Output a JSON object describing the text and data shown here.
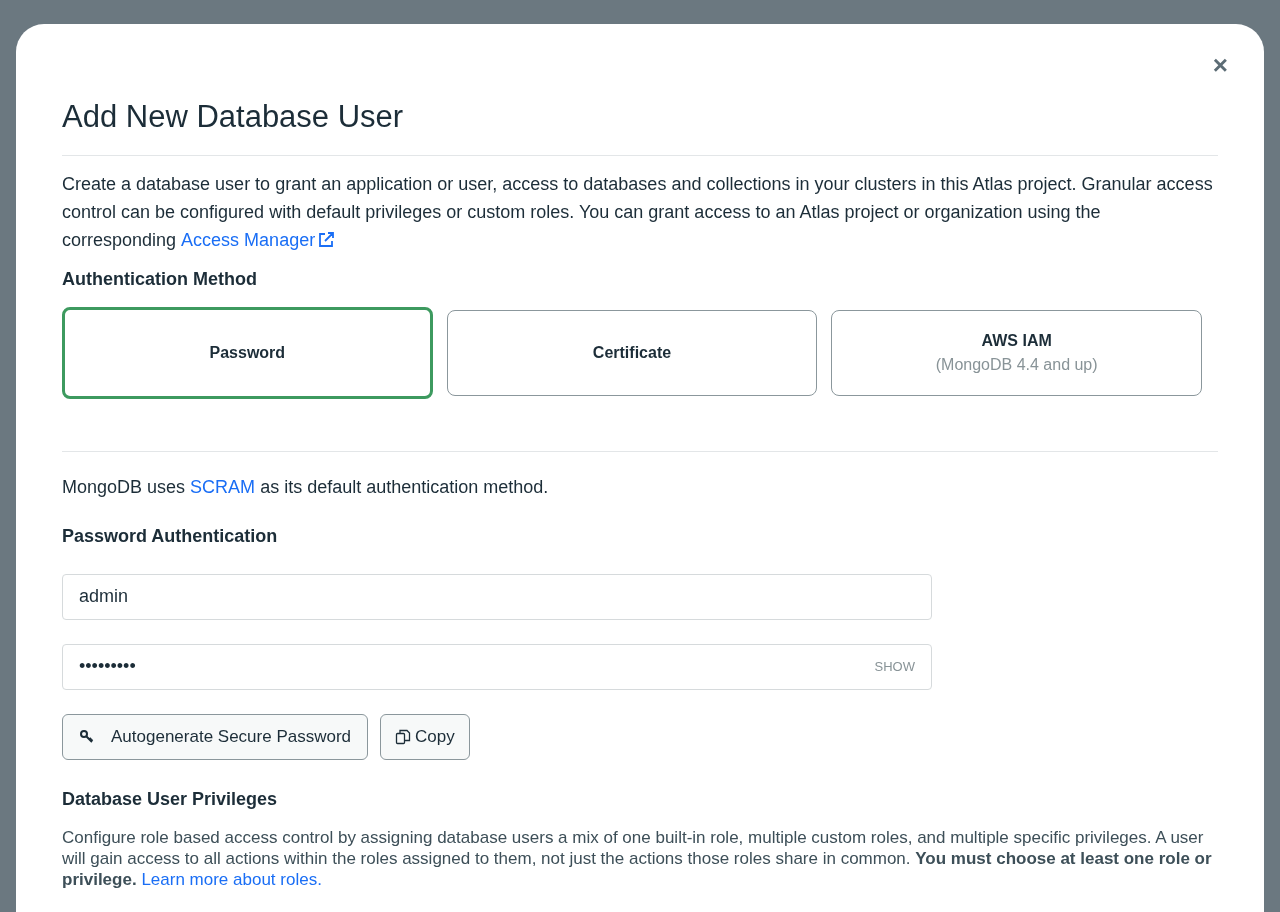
{
  "dialog": {
    "title": "Add New Database User",
    "close": "×",
    "intro": {
      "text": "Create a database user to grant an application or user, access to databases and collections in your clusters in this Atlas project. Granular access control can be configured with default privileges or custom roles. You can grant access to an Atlas project or organization using the corresponding",
      "link": "Access Manager"
    },
    "auth_heading": "Authentication Method",
    "auth_methods": [
      {
        "label": "Password",
        "selected": true
      },
      {
        "label": "Certificate",
        "selected": false
      },
      {
        "label": "AWS IAM",
        "sublabel": "(MongoDB 4.4 and up)",
        "selected": false
      }
    ],
    "scram_note": {
      "before": "MongoDB uses",
      "link": "SCRAM",
      "after": "as its default authentication method."
    },
    "password_heading": "Password Authentication",
    "username": {
      "value": "admin"
    },
    "password": {
      "value": "•••••••••",
      "toggle": "SHOW"
    },
    "buttons": [
      {
        "label": "Autogenerate Secure Password",
        "kind": "key"
      },
      {
        "label": "Copy",
        "kind": "copy"
      }
    ],
    "privileges_heading": "Database User Privileges",
    "privileges_text": {
      "text": "Configure role based access control by assigning database users a mix of one built-in role, multiple custom roles, and multiple specific privileges. A user will gain access to all actions within the roles assigned to them, not just the actions those roles share in common. **You must choose at least one role or privilege.**",
      "link": "Learn more about roles."
    }
  }
}
